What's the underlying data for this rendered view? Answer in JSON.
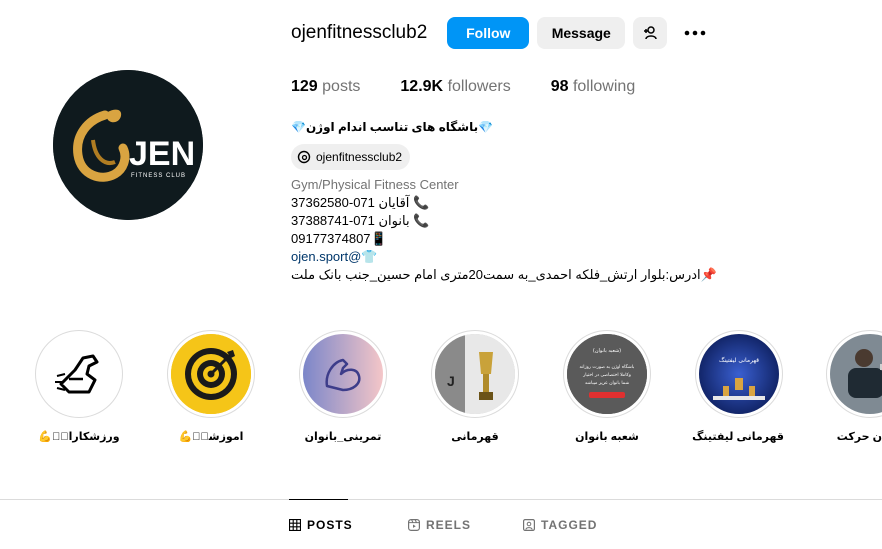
{
  "profile": {
    "username": "ojenfitnessclub2",
    "follow_label": "Follow",
    "message_label": "Message",
    "avatar_text": "JEN",
    "avatar_subtext": "FITNESS CLUB"
  },
  "stats": {
    "posts_count": "129",
    "posts_label": "posts",
    "followers_count": "12.9K",
    "followers_label": "followers",
    "following_count": "98",
    "following_label": "following"
  },
  "bio": {
    "name": "💎باشگاه های تناسب اندام اوژن💎",
    "threads_handle": "ojenfitnessclub2",
    "category": "Gym/Physical Fitness Center",
    "line1": "📞 آقایان 071-37362580",
    "line2": "📞 بانوان 071-37388741",
    "line3": "09177374807📱",
    "link": "ojen.sport@",
    "link_suffix": "👕",
    "address": "📌ادرس:بلوار ارتش_فلکه احمدی_به سمت20متری امام حسین_جنب بانک ملت"
  },
  "highlights": [
    {
      "label": "ورزشکاران🏻💪"
    },
    {
      "label": "اموزشی🏻💪"
    },
    {
      "label": "تمرینی_بانوان"
    },
    {
      "label": "قهرمانی"
    },
    {
      "label": "شعبه بانوان"
    },
    {
      "label": "قهرمانی لیفتینگ"
    },
    {
      "label": "ن حرکت"
    }
  ],
  "highlight_texts": {
    "banovan_title": "(شعبه بانوان)",
    "banovan_body1": "باشگاه اوژن به صورت روزانه",
    "banovan_body2": "وکاملا اختصاصی در اختیار",
    "banovan_body3": "شما بانوان عزیز میباشد",
    "lifting_title": "قهرمانی لیفتینگ"
  },
  "tabs": {
    "posts": "POSTS",
    "reels": "REELS",
    "tagged": "TAGGED"
  },
  "colors": {
    "follow_blue": "#0095f6",
    "secondary_gray": "#efefef",
    "link_blue": "#00376b",
    "muted_text": "#737373",
    "logo_gold": "#d9a441",
    "target_yellow": "#f5c518"
  }
}
